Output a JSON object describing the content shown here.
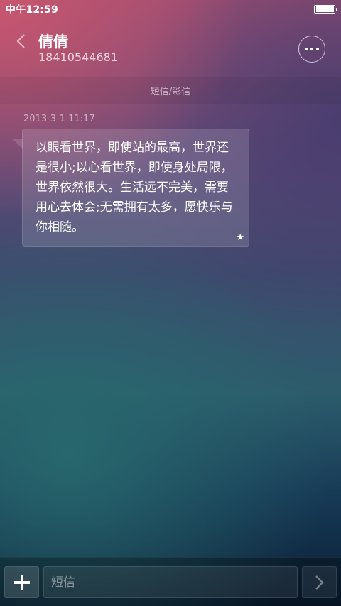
{
  "status_bar": {
    "time": "中午12:59",
    "battery_level": 1.0
  },
  "header": {
    "contact_name": "倩倩",
    "phone_number": "18410544681",
    "back_icon": "chevron-left-icon",
    "more_icon": "more-dots-icon"
  },
  "conversation": {
    "type_label": "短信/彩信",
    "messages": [
      {
        "timestamp": "2013-3-1 11:17",
        "text": "以眼看世界，即使站的最高，世界还是很小;以心看世界，即使身处局限，世界依然很大。生活远不完美，需要用心去体会;无需拥有太多，愿快乐与你相随。",
        "starred": true,
        "star_glyph": "★"
      }
    ]
  },
  "composer": {
    "placeholder": "短信",
    "value": "",
    "add_icon": "plus-icon",
    "send_icon": "chevron-right-icon"
  }
}
